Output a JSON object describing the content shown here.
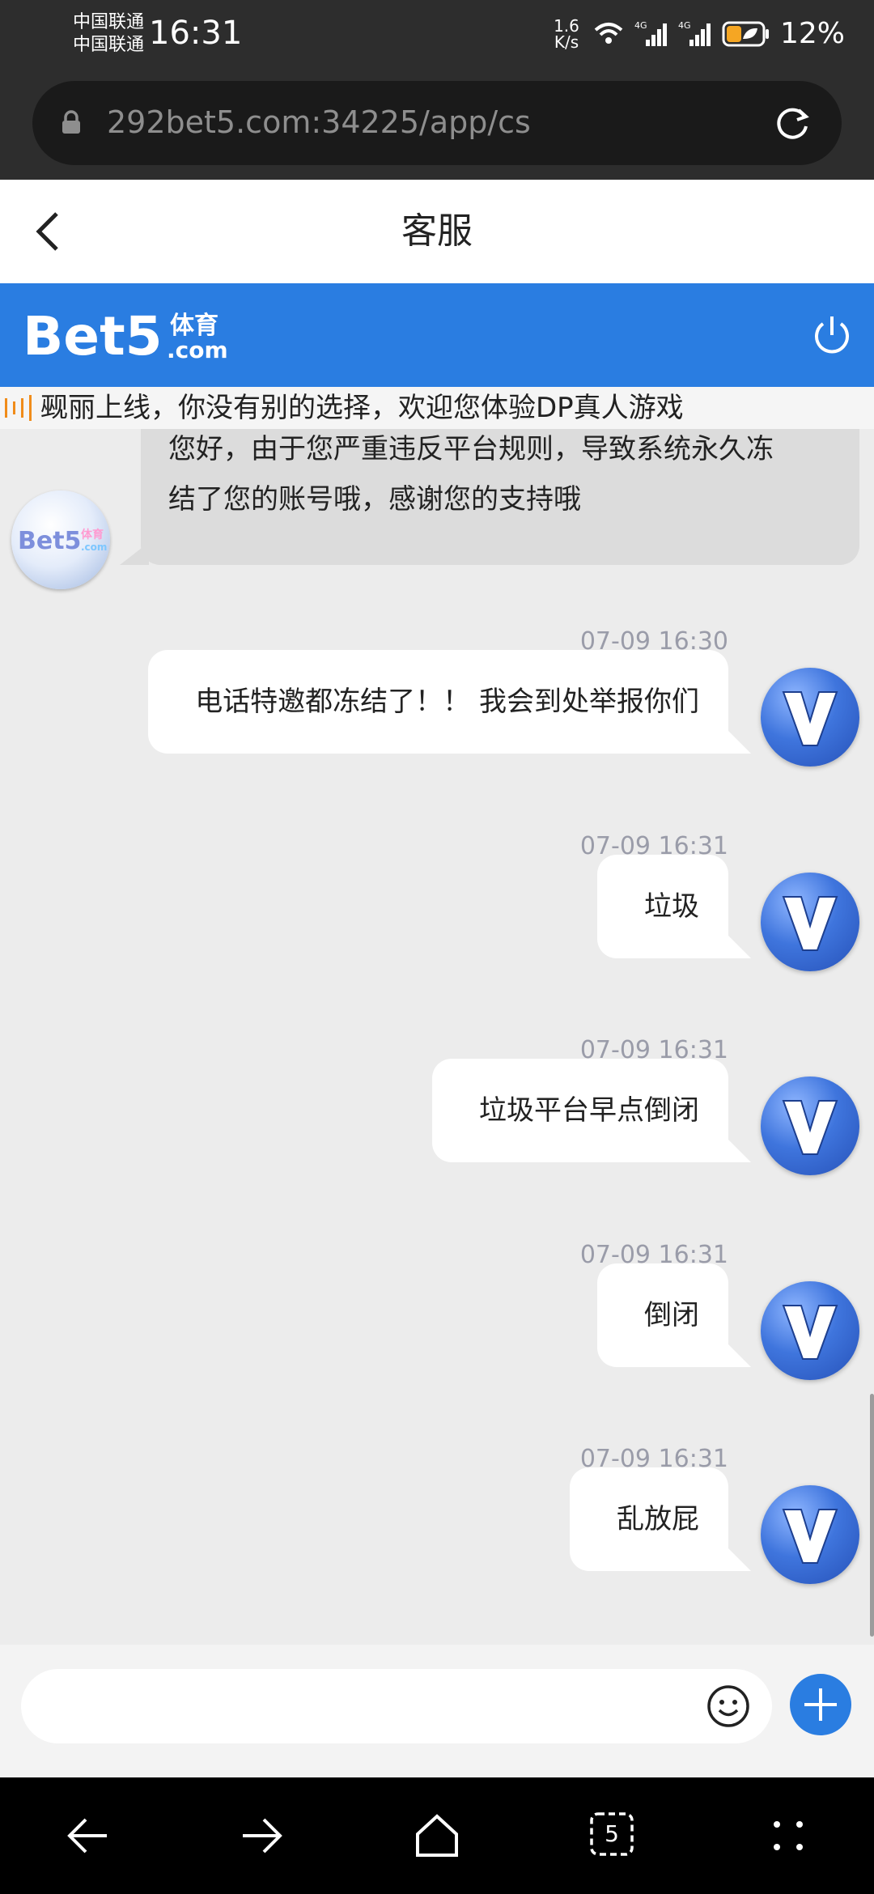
{
  "status_bar": {
    "carrier_1": "中国联通",
    "carrier_2": "中国联通",
    "time": "16:31",
    "net_speed_value": "1.6",
    "net_speed_unit": "K/s",
    "battery_percent": "12%"
  },
  "browser": {
    "url": "292bet5.com:34225/app/cs"
  },
  "header": {
    "title": "客服"
  },
  "brand": {
    "logo_text": "Bet5",
    "logo_cn": "体育",
    "logo_suffix": ".com",
    "accent_color": "#2a7de1"
  },
  "marquee": {
    "text": "觋丽上线，你没有别的选择，欢迎您体验DP真人游戏"
  },
  "chat": {
    "incoming": {
      "line1": "您好，由于您严重违反平台规则，导致系统永久冻",
      "line2": "结了您的账号哦，感谢您的支持哦"
    },
    "messages": [
      {
        "timestamp": "07-09 16:30",
        "text": "电话特邀都冻结了！！ 我会到处举报你们"
      },
      {
        "timestamp": "07-09 16:31",
        "text": "垃圾"
      },
      {
        "timestamp": "07-09 16:31",
        "text": "垃圾平台早点倒闭"
      },
      {
        "timestamp": "07-09 16:31",
        "text": "倒闭"
      },
      {
        "timestamp": "07-09 16:31",
        "text": "乱放屁"
      }
    ]
  },
  "input": {
    "placeholder": ""
  },
  "nav": {
    "tab_count": "5"
  },
  "icons": {
    "back": "back-arrow-icon",
    "power": "power-icon",
    "emoji": "emoji-icon",
    "plus": "plus-icon",
    "lock": "lock-icon",
    "reload": "reload-icon",
    "user_avatar": "v-avatar-icon"
  }
}
